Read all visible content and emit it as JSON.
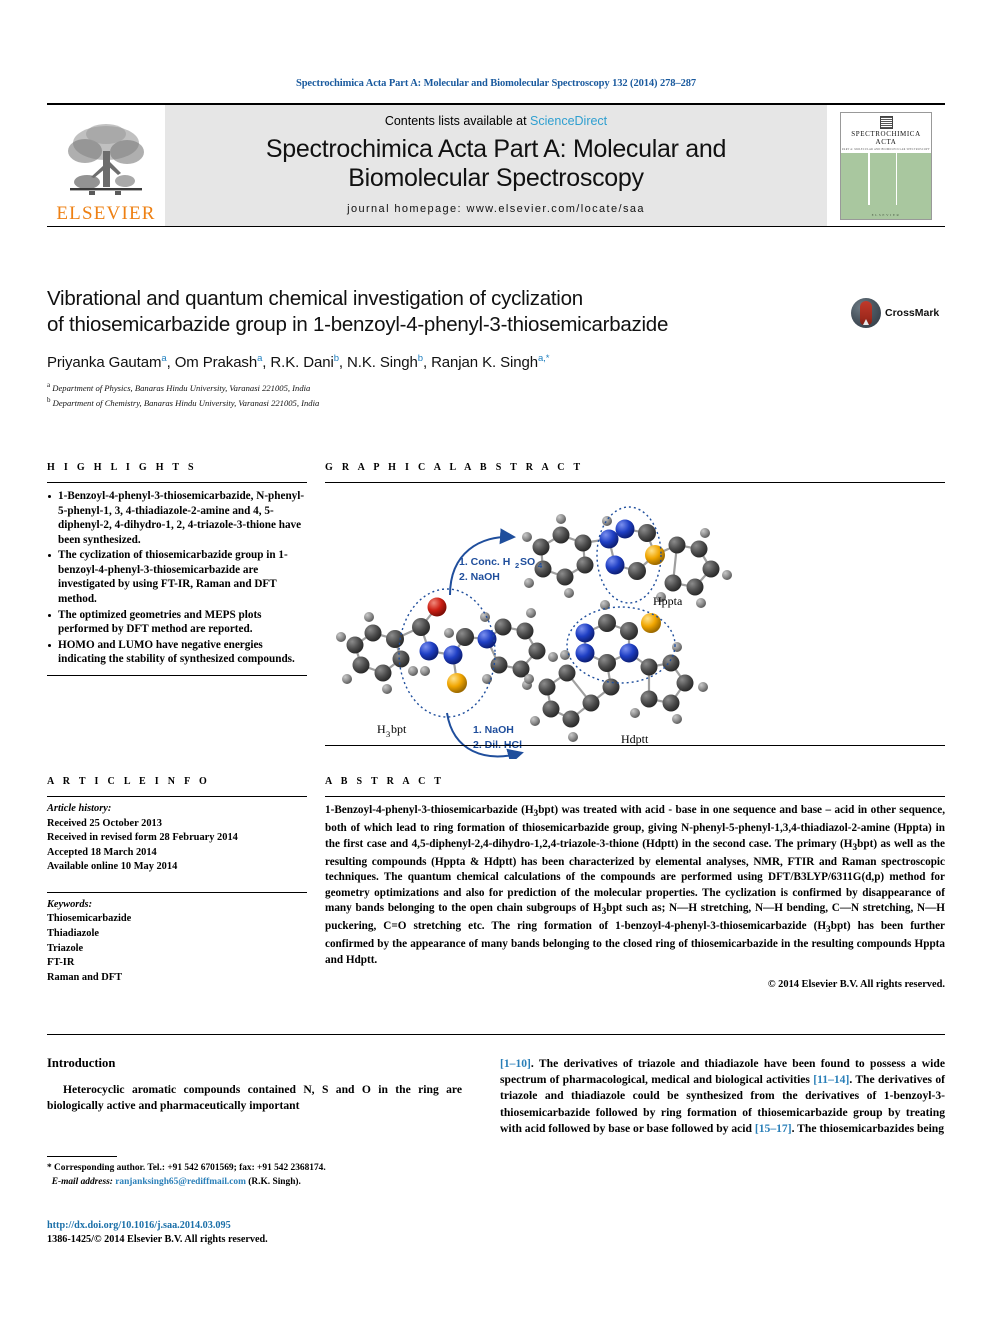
{
  "running_head": "Spectrochimica Acta Part A: Molecular and Biomolecular Spectroscopy 132 (2014) 278–287",
  "masthead": {
    "publisher": "ELSEVIER",
    "contents_prefix": "Contents lists available at ",
    "contents_link": "ScienceDirect",
    "journal_title_line1": "Spectrochimica Acta Part A: Molecular and",
    "journal_title_line2": "Biomolecular Spectroscopy",
    "homepage": "journal homepage: www.elsevier.com/locate/saa",
    "cover_title_line1": "SPECTROCHIMICA",
    "cover_title_line2": "ACTA",
    "cover_subtitle": "PART A: MOLECULAR AND BIOMOLECULAR SPECTROSCOPY",
    "cover_footer": "ELSEVIER"
  },
  "article": {
    "title_line1": "Vibrational and quantum chemical investigation of cyclization",
    "title_line2": "of thiosemicarbazide group in 1-benzoyl-4-phenyl-3-thiosemicarbazide",
    "authors": "Priyanka Gautam a, Om Prakash a, R.K. Dani b, N.K. Singh b, Ranjan K. Singh a,*",
    "affiliation_a": "Department of Physics, Banaras Hindu University, Varanasi 221005, India",
    "affiliation_b": "Department of Chemistry, Banaras Hindu University, Varanasi 221005, India",
    "crossmark_label": "CrossMark"
  },
  "highlights": {
    "heading": "H I G H L I G H T S",
    "items": [
      "1-Benzoyl-4-phenyl-3-thiosemicarbazide, N-phenyl-5-phenyl-1, 3, 4-thiadiazole-2-amine and 4, 5-diphenyl-2, 4-dihydro-1, 2, 4-triazole-3-thione have been synthesized.",
      "The cyclization of thiosemicarbazide group in 1-benzoyl-4-phenyl-3-thiosemicarbazide are investigated by using FT-IR, Raman and DFT method.",
      "The optimized geometries and MEPS plots performed by DFT method are reported.",
      "HOMO and LUMO have negative energies indicating the stability of synthesized compounds."
    ]
  },
  "article_info": {
    "heading": "A R T I C L E    I N F O",
    "history_label": "Article history:",
    "history": [
      "Received 25 October 2013",
      "Received in revised form 28 February 2014",
      "Accepted 18 March 2014",
      "Available online 10 May 2014"
    ],
    "keywords_label": "Keywords:",
    "keywords": [
      "Thiosemicarbazide",
      "Thiadiazole",
      "Triazole",
      "FT-IR",
      "Raman and DFT"
    ]
  },
  "graphical_abstract": {
    "heading": "G R A P H I C A L   A B S T R A C T",
    "labels": {
      "reactant": "H3bpt",
      "product_top": "Hppta",
      "product_bottom": "Hdptt",
      "arrow_top_line1": "1. Conc. H2SO4",
      "arrow_top_line2": "2. NaOH",
      "arrow_bottom_line1": "1. NaOH",
      "arrow_bottom_line2": "2. Dil. HCl"
    },
    "colors": {
      "carbon": "#4d4d4d",
      "hydrogen": "#808080",
      "nitrogen": "#1430b0",
      "oxygen": "#cc1414",
      "sulfur": "#f0a500",
      "annotation": "#1f4e9c"
    }
  },
  "abstract": {
    "heading": "A B S T R A C T",
    "body": "1-Benzoyl-4-phenyl-3-thiosemicarbazide (H3bpt) was treated with acid - base in one sequence and base – acid in other sequence, both of which lead to ring formation of thiosemicarbazide group, giving N-phenyl-5-phenyl-1,3,4-thiadiazol-2-amine (Hppta) in the first case and 4,5-diphenyl-2,4-dihydro-1,2,4-triazole-3-thione (Hdptt) in the second case. The primary (H3bpt) as well as the resulting compounds (Hppta & Hdptt) has been characterized by elemental analyses, NMR, FTIR and Raman spectroscopic techniques. The quantum chemical calculations of the compounds are performed using DFT/B3LYP/6311G(d,p) method for geometry optimizations and also for prediction of the molecular properties. The cyclization is confirmed by disappearance of many bands belonging to the open chain subgroups of H3bpt such as; N—H stretching, N—H bending, C—N stretching, N—H puckering, C=O stretching etc. The ring formation of 1-benzoyl-4-phenyl-3-thiosemicarbazide (H3bpt) has been further confirmed by the appearance of many bands belonging to the closed ring of thiosemicarbazide in the resulting compounds Hppta and Hdptt.",
    "copyright": "© 2014 Elsevier B.V. All rights reserved."
  },
  "body": {
    "intro_heading": "Introduction",
    "left_paragraph": "Heterocyclic aromatic compounds contained N, S and O in the ring are biologically active and pharmaceutically important",
    "right_paragraph_parts": [
      "[1–10]",
      ". The derivatives of triazole and thiadiazole have been found to possess a wide spectrum of pharmacological, medical and biological activities ",
      "[11–14]",
      ". The derivatives of triazole and thiadiazole could be synthesized from the derivatives of 1-benzoyl-3-thiosemicarbazide followed by ring formation of thiosemicarbazide group by treating with acid followed by base or base followed by acid ",
      "[15–17]",
      ". The thiosemicarbazides being"
    ]
  },
  "footnote": {
    "corresponding": "* Corresponding author. Tel.: +91 542 6701569; fax: +91 542 2368174.",
    "email_label": "E-mail address:",
    "email": "ranjanksingh65@rediffmail.com",
    "email_suffix": "(R.K. Singh)."
  },
  "footer": {
    "doi": "http://dx.doi.org/10.1016/j.saa.2014.03.095",
    "issn_line": "1386-1425/© 2014 Elsevier B.V. All rights reserved."
  }
}
